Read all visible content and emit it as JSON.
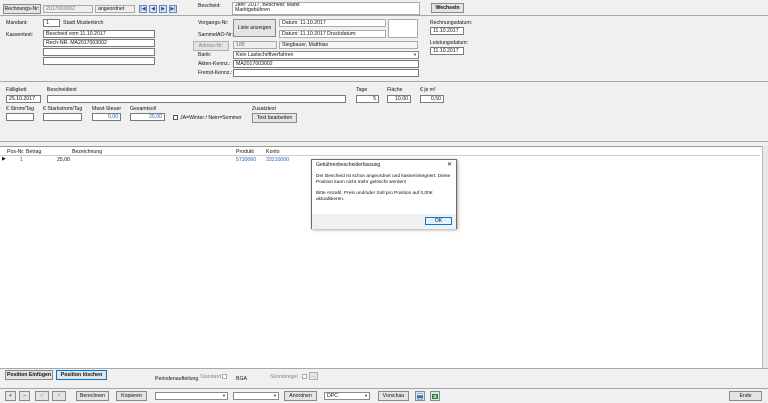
{
  "header": {
    "rechnung_label": "Rechnungs-Nr:",
    "rechnung_value": "2017003002",
    "status": "angeordnet",
    "bescheid_label": "Bescheid:",
    "bescheid_text_1": "Jahr: 2017, Bescheid: Markt",
    "bescheid_text_2": "Marktgebühren",
    "wechseln_label": "Wechseln",
    "mandant_label": "Mandant:",
    "mandant_nr": "1",
    "mandant_name": "Stadt Musterkirch",
    "kassentext_label": "Kassentext:",
    "kassentext_1": "Bescheid vom 11.10.2017",
    "kassentext_2": "Rech-NR. MA2017003002",
    "vorgangs_label": "Vorgangs-Nr:",
    "sammelao_label": "SammelAO-Nr:",
    "liste_anzeigen": "Liste anzeigen",
    "datum_1": "Datum:  11.10.2017",
    "datum_2": "Datum:  11.10.2017  Druckdatum:",
    "adress_label": "Adress-Nr:",
    "adress_nr": "188",
    "adress_name": "Stegbauer, Matthias",
    "bank_label": "Bank:",
    "bank_value": "Kein Lastschriftverfahren",
    "akten_label": "Akten-Kennz.:",
    "akten_value": "MA2017003002",
    "fremd_label": "Fremd-Kennz.:",
    "rechnungsdatum_label": "Rechnungsdatum:",
    "rechnungsdatum": "11.10.2017",
    "leistungsdatum_label": "Leistungsdatum:",
    "leistungsdatum": "11.10.2017"
  },
  "position": {
    "faelligkeit_label": "Fälligkeit",
    "faelligkeit": "25.10.2017",
    "bescheidtext_label": "Bescheidtext",
    "tage_label": "Tage",
    "tage": "5",
    "flaeche_label": "Fläche",
    "flaeche": "10,00",
    "je_m2_label": "€ je m²",
    "je_m2": "0,50",
    "strom_label": "€ Strom/Tag",
    "starkstrom_label": "€ Starkstrom/Tag",
    "mwst_label": "Mwst-Steuer",
    "mwst": "0,00",
    "gesamt_label": "Gesamtsoll",
    "gesamt": "25,00",
    "ja_weiter_label": "JA=Winter / Nein=Sommer",
    "zusatztext_label": "Zusatztext",
    "text_bearbeiten": "Text bearbeiten"
  },
  "grid": {
    "columns": [
      "Pos-Nr.",
      "Betrag",
      "Bezeichnung",
      "Produkt",
      "Konto"
    ],
    "rows": [
      {
        "pos": "1",
        "betrag": "25,00",
        "bezeichnung": "",
        "produkt": "5730060",
        "konto": "33210000"
      }
    ]
  },
  "dialog": {
    "title": "Gebührenbescheiderfassung",
    "close": "✕",
    "line1": "Der Bescheid ist schon angeordnet und kassenintegriert. Diese",
    "line2": "Position kann nicht mehr gelöscht werden!",
    "line3": "Bitte Anzahl, Preis und/oder Soll pro Position auf 0,00€",
    "line4": "aktualisieren.",
    "ok": "OK"
  },
  "footer_bar": {
    "position_einfuegen": "Position Einfügen",
    "position_loeschen": "Position löschen",
    "periodenaufteilung": "Periodenaufteilung",
    "standard": "Standard",
    "bga": "BGA",
    "skontoregel": "Skontoregel"
  },
  "bottom": {
    "berechnen": "Berechnen",
    "kopieren": "Kopieren",
    "anordnen": "Anordnen",
    "dpc": "DPC",
    "vorschau": "Vorschau",
    "ende": "Ende",
    "plus": "+",
    "minus": "−",
    "check": "✓",
    "x": "×"
  },
  "colors": {
    "accent_blue": "#0078d7",
    "link_blue": "#2266bb",
    "red": "#cc2222"
  }
}
